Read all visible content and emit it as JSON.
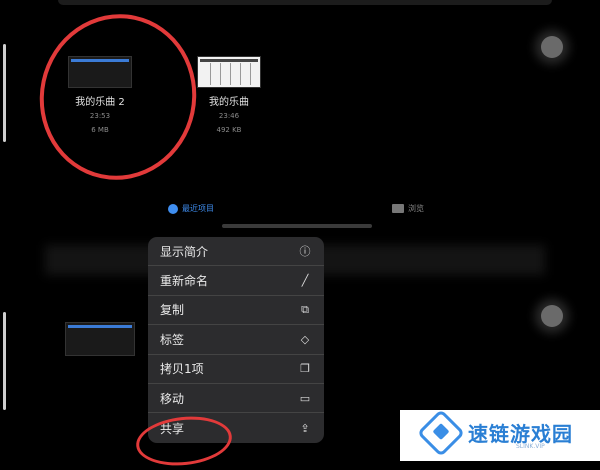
{
  "files": [
    {
      "name": "我的乐曲 2",
      "time": "23:53",
      "size": "6 MB",
      "thumbnail": "blank"
    },
    {
      "name": "我的乐曲",
      "time": "23:46",
      "size": "492 KB",
      "thumbnail": "grid"
    }
  ],
  "tabs": {
    "recent": {
      "label": "最近项目",
      "icon": "clock-icon"
    },
    "browse": {
      "label": "浏览",
      "icon": "folder-icon"
    }
  },
  "context_menu": [
    {
      "label": "显示简介",
      "icon": "info-icon",
      "glyph": "ⓘ"
    },
    {
      "label": "重新命名",
      "icon": "pencil-icon",
      "glyph": "╱"
    },
    {
      "label": "复制",
      "icon": "duplicate-icon",
      "glyph": "⧉"
    },
    {
      "label": "标签",
      "icon": "tag-icon",
      "glyph": "◇"
    },
    {
      "label": "拷贝1项",
      "icon": "copy-icon",
      "glyph": "❐"
    },
    {
      "label": "移动",
      "icon": "folder-icon",
      "glyph": "▭"
    },
    {
      "label": "共享",
      "icon": "share-icon",
      "glyph": "⇪"
    }
  ],
  "watermark": {
    "brand": "速链游戏园",
    "site": "SLINK.VIP"
  },
  "colors": {
    "accent": "#3f8ef0",
    "annotation": "#e23a3a",
    "menu_bg": "#2c2c2e"
  }
}
